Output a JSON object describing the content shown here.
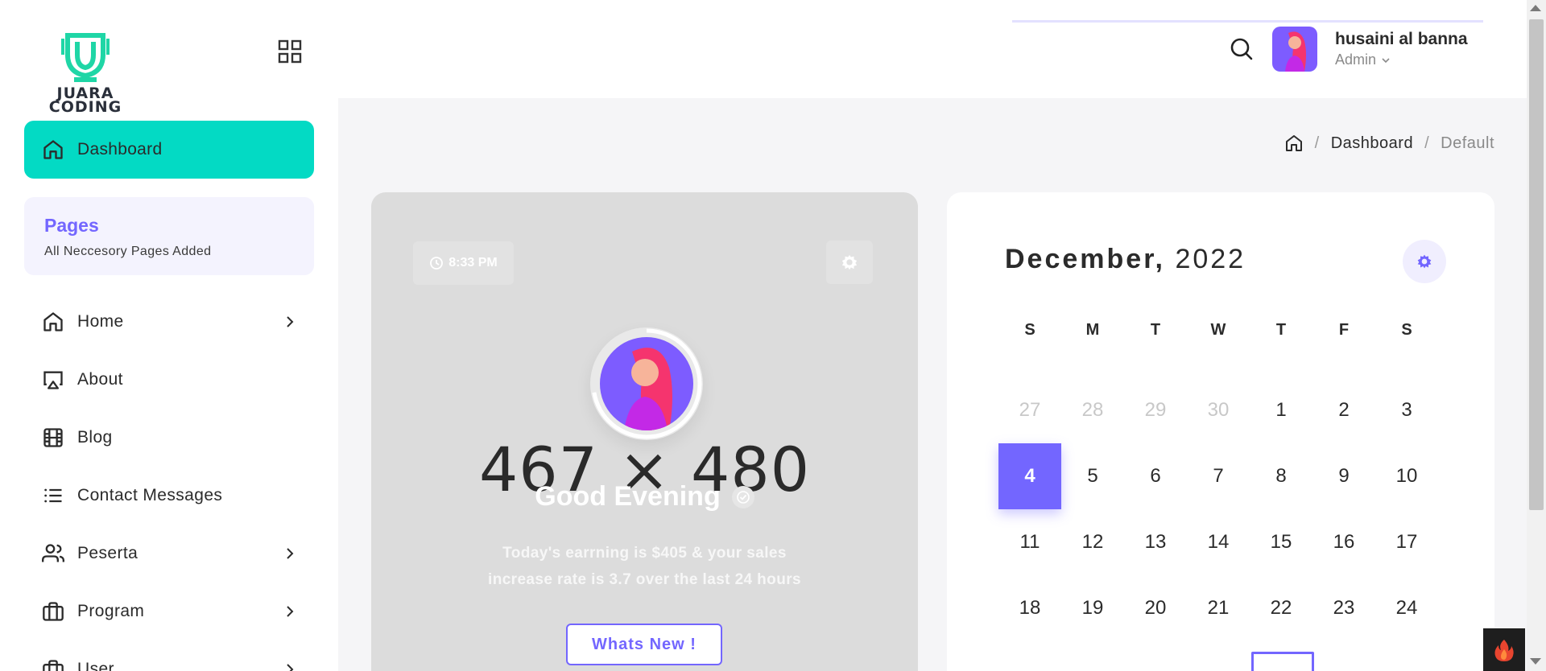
{
  "brand": {
    "logo_text": "JUARA CODING",
    "accent": "#03dac4",
    "primary": "#7366ff"
  },
  "sidebar": {
    "active": {
      "label": "Dashboard",
      "icon": "home-icon"
    },
    "pages_box": {
      "title": "Pages",
      "subtitle": "All Neccesory Pages Added"
    },
    "items": [
      {
        "label": "Home",
        "icon": "home-icon",
        "has_children": true
      },
      {
        "label": "About",
        "icon": "airplay-icon",
        "has_children": false
      },
      {
        "label": "Blog",
        "icon": "film-icon",
        "has_children": false
      },
      {
        "label": "Contact Messages",
        "icon": "list-icon",
        "has_children": false
      },
      {
        "label": "Peserta",
        "icon": "users-icon",
        "has_children": true
      },
      {
        "label": "Program",
        "icon": "briefcase-icon",
        "has_children": true
      },
      {
        "label": "User",
        "icon": "briefcase-icon",
        "has_children": true
      }
    ]
  },
  "header": {
    "user_name": "husaini al banna",
    "user_role": "Admin"
  },
  "breadcrumb": {
    "link": "Dashboard",
    "current": "Default"
  },
  "welcome": {
    "time": "8:33 PM",
    "placeholder": "467 × 480",
    "greeting": "Good Evening",
    "message_line1": "Today's earrning is $405 & your sales",
    "message_line2": "increase rate is 3.7 over the last 24 hours",
    "button": "Whats New !"
  },
  "calendar": {
    "month": "December,",
    "year": "2022",
    "days_of_week": [
      "S",
      "M",
      "T",
      "W",
      "T",
      "F",
      "S"
    ],
    "weeks": [
      [
        {
          "d": "27",
          "m": true
        },
        {
          "d": "28",
          "m": true
        },
        {
          "d": "29",
          "m": true
        },
        {
          "d": "30",
          "m": true
        },
        {
          "d": "1"
        },
        {
          "d": "2"
        },
        {
          "d": "3"
        }
      ],
      [
        {
          "d": "4",
          "today": true
        },
        {
          "d": "5"
        },
        {
          "d": "6"
        },
        {
          "d": "7"
        },
        {
          "d": "8"
        },
        {
          "d": "9"
        },
        {
          "d": "10"
        }
      ],
      [
        {
          "d": "11"
        },
        {
          "d": "12"
        },
        {
          "d": "13"
        },
        {
          "d": "14"
        },
        {
          "d": "15"
        },
        {
          "d": "16"
        },
        {
          "d": "17"
        }
      ],
      [
        {
          "d": "18"
        },
        {
          "d": "19"
        },
        {
          "d": "20"
        },
        {
          "d": "21"
        },
        {
          "d": "22"
        },
        {
          "d": "23"
        },
        {
          "d": "24"
        }
      ]
    ]
  }
}
